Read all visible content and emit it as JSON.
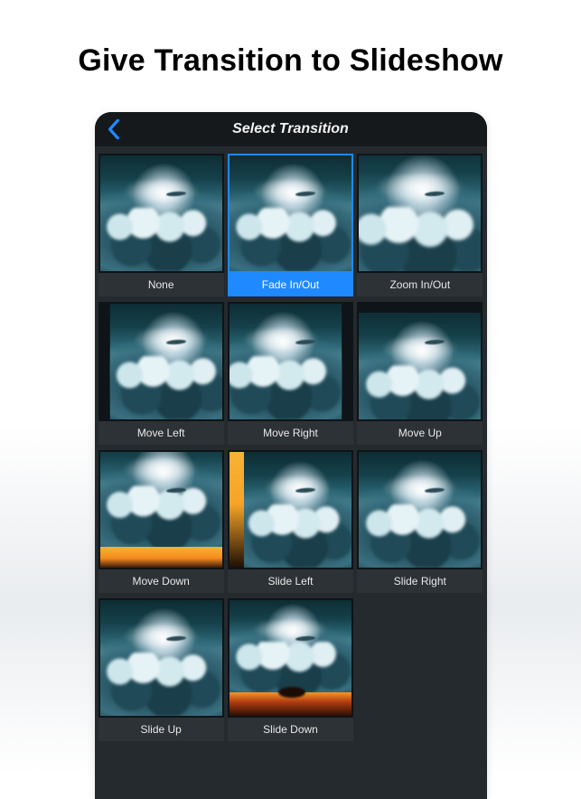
{
  "promo": {
    "title": "Give Transition to Slideshow"
  },
  "navbar": {
    "title": "Select Transition"
  },
  "colors": {
    "accent": "#1f89ff"
  },
  "transitions": [
    {
      "label": "None",
      "kind": "t-none",
      "selected": false
    },
    {
      "label": "Fade In/Out",
      "kind": "t-none",
      "selected": true
    },
    {
      "label": "Zoom In/Out",
      "kind": "t-zoom",
      "selected": false
    },
    {
      "label": "Move Left",
      "kind": "t-mleft",
      "selected": false
    },
    {
      "label": "Move Right",
      "kind": "t-mright",
      "selected": false
    },
    {
      "label": "Move Up",
      "kind": "t-mup",
      "selected": false
    },
    {
      "label": "Move Down",
      "kind": "t-mdown",
      "selected": false
    },
    {
      "label": "Slide Left",
      "kind": "t-sleft",
      "selected": false
    },
    {
      "label": "Slide Right",
      "kind": "t-sright",
      "selected": false
    },
    {
      "label": "Slide Up",
      "kind": "t-sup",
      "selected": false
    },
    {
      "label": "Slide Down",
      "kind": "t-sdown",
      "selected": false
    }
  ]
}
